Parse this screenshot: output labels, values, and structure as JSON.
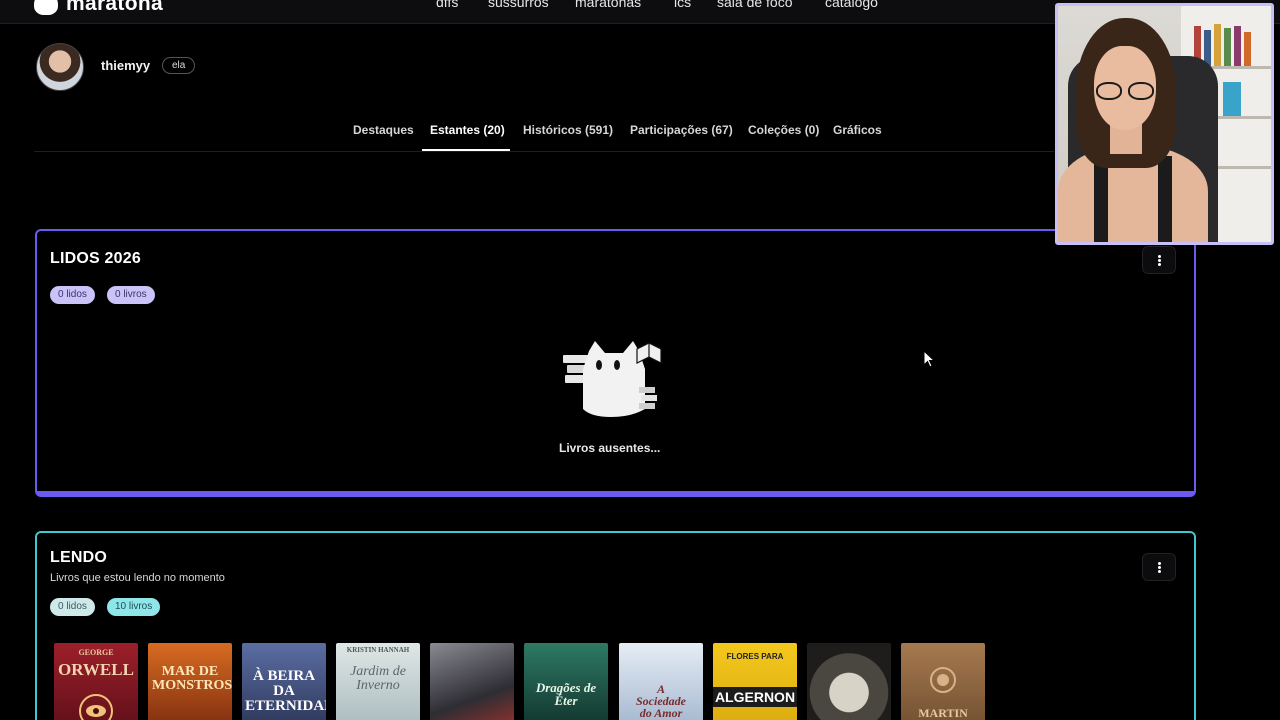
{
  "brand": {
    "name": "maratona"
  },
  "nav": {
    "items": [
      "dffs",
      "sussurros",
      "maratonas",
      "ics",
      "sala de foco",
      "catálogo"
    ]
  },
  "profile": {
    "username": "thiemyy",
    "pronoun": "ela"
  },
  "tabs": [
    "Destaques",
    "Estantes (20)",
    "Históricos (591)",
    "Participações (67)",
    "Coleções (0)",
    "Gráficos"
  ],
  "active_tab": "Estantes (20)",
  "shelves": [
    {
      "title": "LIDOS 2026",
      "subtitle": "",
      "pills": [
        "0 lidos",
        "0 livros"
      ],
      "empty_text": "Livros ausentes...",
      "color": "#6a5af0"
    },
    {
      "title": "LENDO",
      "subtitle": "Livros que estou lendo no momento",
      "pills": [
        "0 lidos",
        "10 livros"
      ],
      "color": "#3ec8cf",
      "books": [
        {
          "text": "ORWELL",
          "top": "GEORGE",
          "color": "#8a1c26"
        },
        {
          "text": "MAR DE MONSTROS",
          "color": "#c9521c"
        },
        {
          "text": "À BEIRA DA ETERNIDADE",
          "color": "#4a5a8c"
        },
        {
          "text": "Jardim de Inverno",
          "top": "KRISTIN HANNAH",
          "color": "#b9c6c7"
        },
        {
          "text": "",
          "color": "#5b5a63"
        },
        {
          "text": "Dragões de Éter",
          "color": "#1f5a4c"
        },
        {
          "text": "A Sociedade do Amor",
          "color": "#cfd9e6"
        },
        {
          "text": "ALGERNON",
          "top": "FLORES PARA",
          "color": "#f0c419"
        },
        {
          "text": "",
          "color": "#3c3a36"
        },
        {
          "text": "MARTIN",
          "color": "#9a6f49"
        }
      ]
    }
  ]
}
